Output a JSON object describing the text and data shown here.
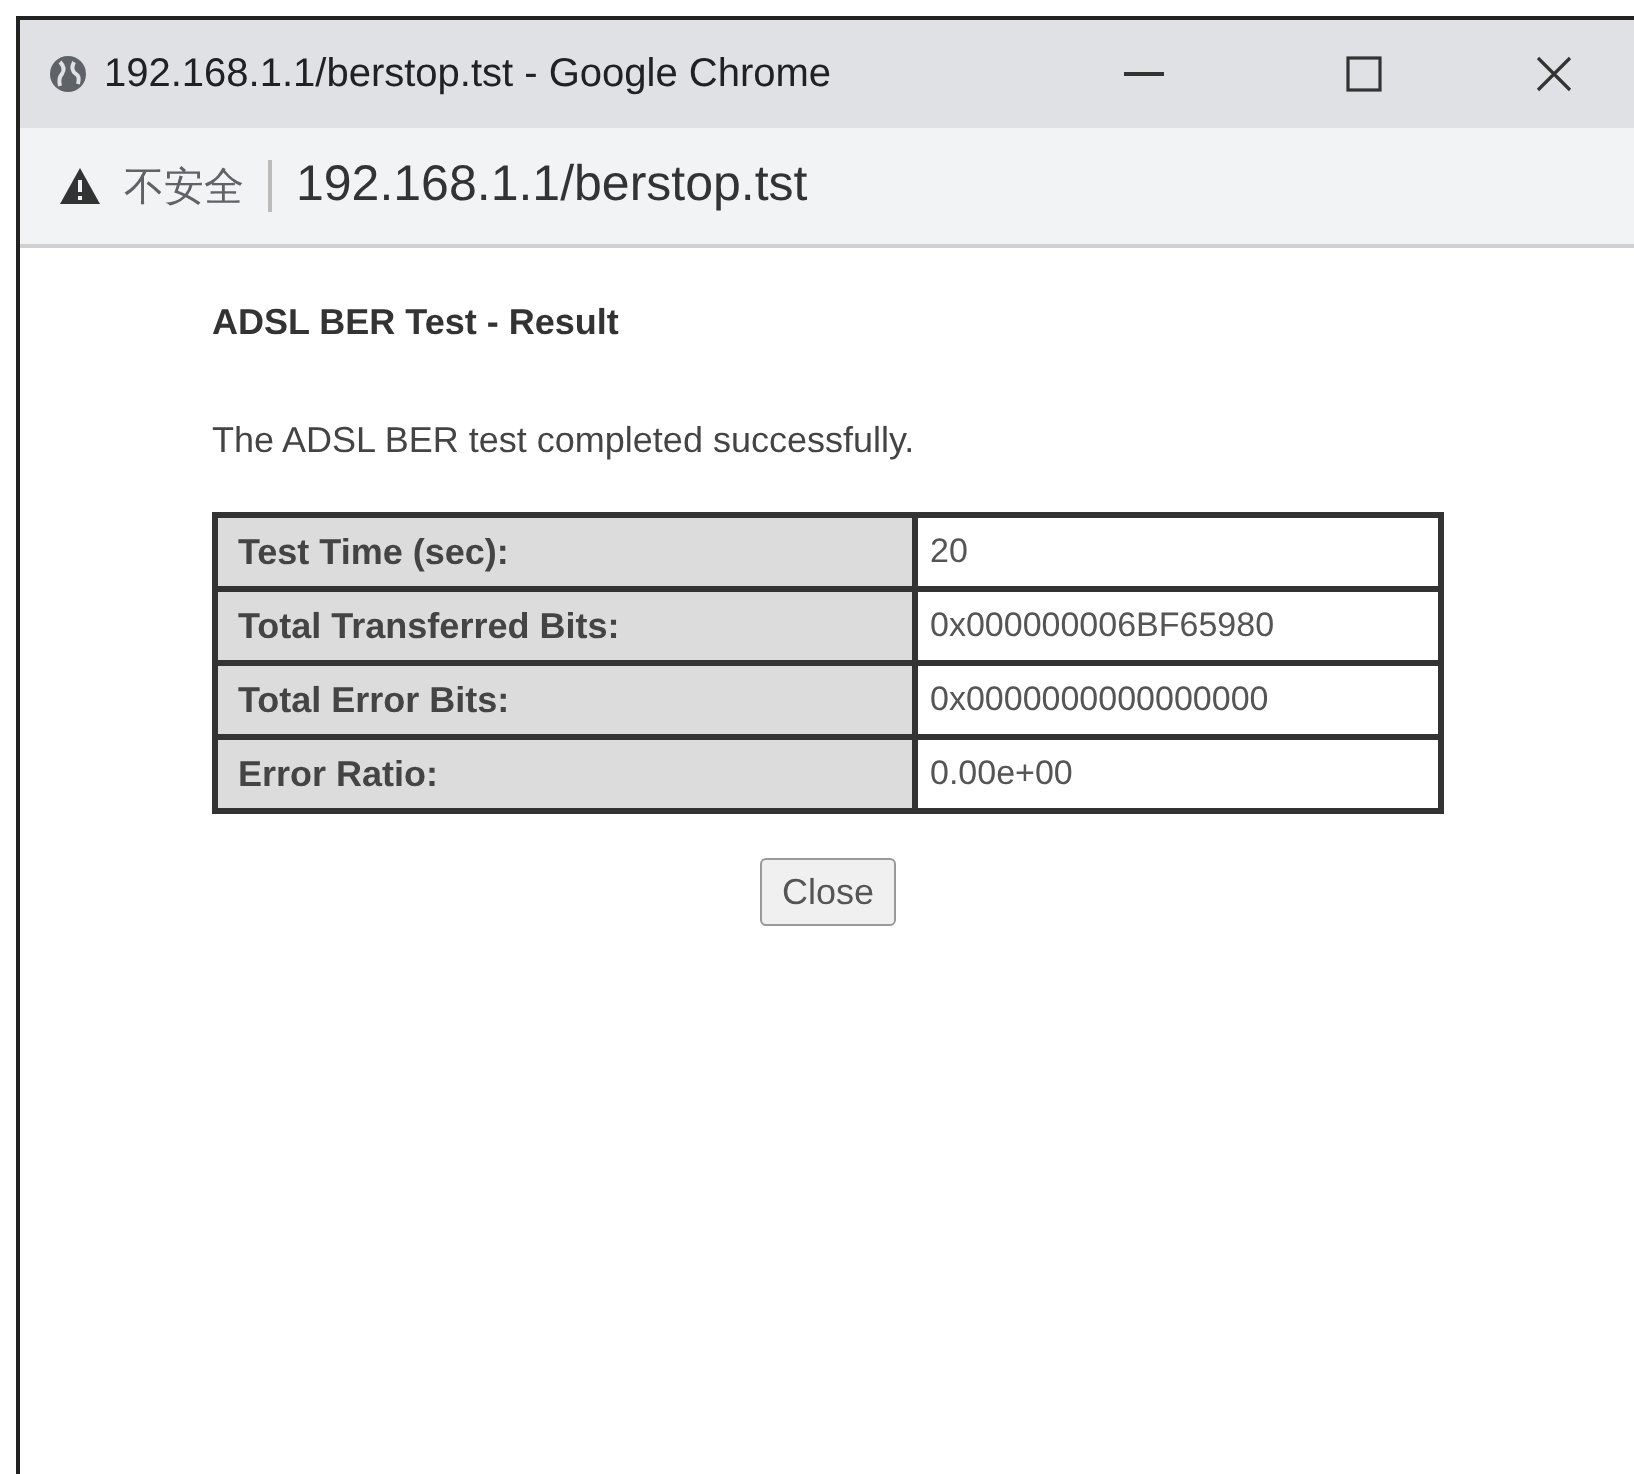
{
  "window": {
    "title": "192.168.1.1/berstop.tst - Google Chrome"
  },
  "address_bar": {
    "security_label": "不安全",
    "url": "192.168.1.1/berstop.tst"
  },
  "page": {
    "heading": "ADSL BER Test - Result",
    "message": "The ADSL BER test completed successfully.",
    "rows": [
      {
        "label": "Test Time (sec):",
        "value": "20"
      },
      {
        "label": "Total Transferred Bits:",
        "value": "0x000000006BF65980"
      },
      {
        "label": "Total Error Bits:",
        "value": "0x0000000000000000"
      },
      {
        "label": "Error Ratio:",
        "value": "0.00e+00"
      }
    ],
    "button": "Close"
  }
}
